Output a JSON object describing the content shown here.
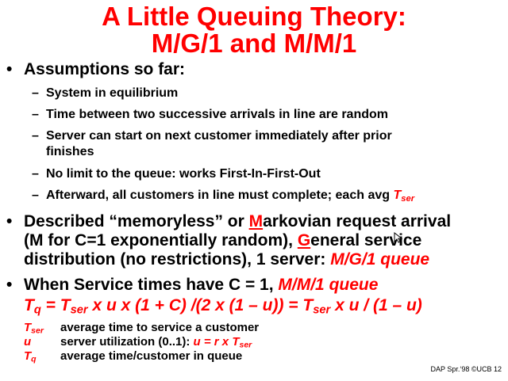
{
  "title": {
    "line1": "A Little Queuing Theory:",
    "line2": "M/G/1 and M/M/1"
  },
  "bullet1": {
    "text": "Assumptions so far:",
    "items": [
      "System in equilibrium",
      "Time between two successive arrivals in line are random",
      "Server can start on next customer immediately after prior",
      "finishes",
      "No limit to the queue: works First-In-First-Out",
      "Afterward, all customers in line must complete; each avg "
    ],
    "tser_T": "T",
    "tser_sub": "ser"
  },
  "bullet2": {
    "line1_a": "Described “memoryless” or ",
    "line1_M": "M",
    "line1_b": "arkovian request arrival",
    "line2_a": "(M for C=1 exponentially random), ",
    "line2_G": "G",
    "line2_b": "eneral service",
    "line3_a": "distribution (no restrictions), 1 server: ",
    "line3_b": "M/G/1 queue"
  },
  "bullet3": {
    "line1_a": "When Service times have C = 1, ",
    "line1_b": "M/M/1 queue"
  },
  "formula": {
    "Tq_T": "T",
    "Tq_sub": "q",
    "eq1": " = ",
    "Ts_T": "T",
    "Ts_sub": "ser",
    "body": " x  u  x (1 + C) /(2 x (1 – u)) =  ",
    "Ts2_T": "T",
    "Ts2_sub": "ser",
    "tail": "  x  u  / (1 – u)"
  },
  "legend": [
    {
      "sym_T": "T",
      "sym_sub": "ser",
      "def": "average time to service a customer"
    },
    {
      "sym_T": "u",
      "sym_sub": "",
      "def": "server utilization (0..1): ",
      "extra": "u = r x T",
      "extra_sub": "ser"
    },
    {
      "sym_T": "T",
      "sym_sub": "q",
      "def": "average time/customer in queue"
    }
  ],
  "footer": "DAP Spr.‘98 ©UCB 12"
}
